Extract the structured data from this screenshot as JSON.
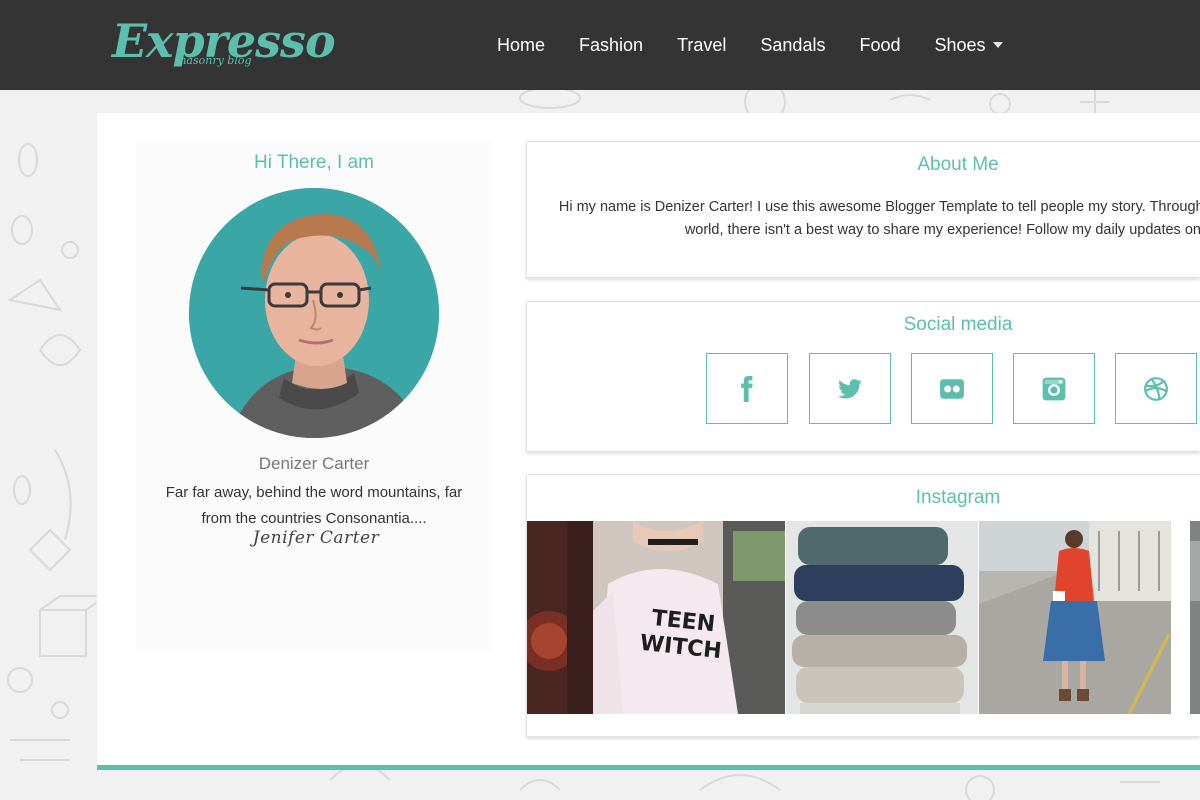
{
  "header": {
    "logo_main": "Expresso",
    "logo_sub": "masonry blog",
    "nav": [
      {
        "label": "Home"
      },
      {
        "label": "Fashion"
      },
      {
        "label": "Travel"
      },
      {
        "label": "Sandals"
      },
      {
        "label": "Food"
      },
      {
        "label": "Shoes",
        "has_dropdown": true
      }
    ]
  },
  "profile": {
    "title": "Hi There, I am",
    "name": "Denizer Carter",
    "bio": "Far far away, behind the word mountains, far from the countries Consonantia....",
    "signature": "Jenifer Carter"
  },
  "about": {
    "title": "About Me",
    "text": "Hi my name is Denizer Carter! I use this awesome Blogger Template to tell people my story. Through things I see around the world, there isn't a best way to share my experience! Follow my daily updates on me!"
  },
  "social": {
    "title": "Social media",
    "icons": [
      "facebook-icon",
      "twitter-icon",
      "flickr-icon",
      "instagram-icon",
      "dribbble-icon"
    ]
  },
  "instagram": {
    "title": "Instagram",
    "photo_text": "TEEN WITCH"
  },
  "colors": {
    "accent": "#5cbfae",
    "header_bg": "#353434",
    "page_bg": "#f1f1f1"
  }
}
